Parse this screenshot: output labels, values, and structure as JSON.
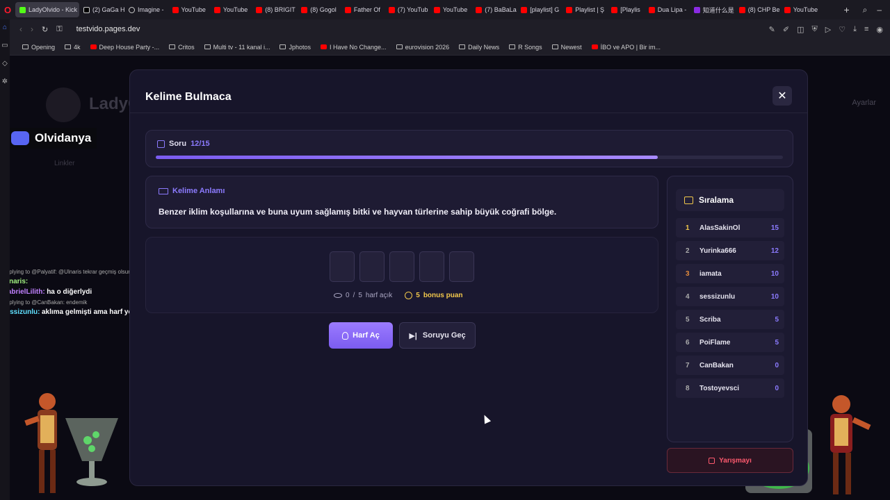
{
  "browser": {
    "tabs": [
      {
        "label": "LadyOlvido - Kick",
        "icon": "kick",
        "active": true
      },
      {
        "label": "(2) GaGa H",
        "icon": "x"
      },
      {
        "label": "Imagine -",
        "icon": "circ"
      },
      {
        "label": "YouTube",
        "icon": "yt"
      },
      {
        "label": "YouTube",
        "icon": "yt"
      },
      {
        "label": "(8) BRIGIT",
        "icon": "yt"
      },
      {
        "label": "(8) Gogol",
        "icon": "yt"
      },
      {
        "label": "Father Of",
        "icon": "yt"
      },
      {
        "label": "(7) YouTub",
        "icon": "yt"
      },
      {
        "label": "YouTube",
        "icon": "yt"
      },
      {
        "label": "(7) BaBaLa",
        "icon": "yt"
      },
      {
        "label": "[playlist] G",
        "icon": "yt"
      },
      {
        "label": "Playlist | Ş",
        "icon": "yt"
      },
      {
        "label": "[Playlis",
        "icon": "yt"
      },
      {
        "label": "Dua Lipa -",
        "icon": "yt"
      },
      {
        "label": "知道什么是",
        "icon": "purple"
      },
      {
        "label": "(8) CHP Be",
        "icon": "yt"
      },
      {
        "label": "YouTube",
        "icon": "yt"
      }
    ],
    "url": "testvido.pages.dev",
    "bookmarks": [
      {
        "label": "Opening",
        "icon": "folder"
      },
      {
        "label": "4k",
        "icon": "folder"
      },
      {
        "label": "Deep House Party -...",
        "icon": "yt"
      },
      {
        "label": "Critos",
        "icon": "folder"
      },
      {
        "label": "Multi tv - 11 kanal i...",
        "icon": "folder"
      },
      {
        "label": "Jphotos",
        "icon": "folder"
      },
      {
        "label": "I Have No Change...",
        "icon": "yt"
      },
      {
        "label": "eurovision 2026",
        "icon": "folder"
      },
      {
        "label": "Daily News",
        "icon": "folder"
      },
      {
        "label": "R Songs",
        "icon": "folder"
      },
      {
        "label": "Newest",
        "icon": "folder"
      },
      {
        "label": "İBO ve APO | Bir im...",
        "icon": "yt"
      }
    ]
  },
  "background": {
    "channel_name": "LadyO",
    "settings_label": "Ayarlar",
    "links_label": "Linkler"
  },
  "overlay": {
    "discord_name": "Olvidanya",
    "chat": [
      {
        "type": "reply",
        "text": "Replying to @Palyatif: @Ulnaris tekrar geçmiş olsun"
      },
      {
        "type": "msg",
        "user": "Ulnaris:",
        "user_class": "user1",
        "text": ""
      },
      {
        "type": "msg",
        "user": "GabrielLilith:",
        "user_class": "user2",
        "text": "ha o diğerlydi"
      },
      {
        "type": "reply",
        "text": "Replying to @CanBakan: endemik"
      },
      {
        "type": "msg",
        "user": "sessizunlu:",
        "user_class": "user3",
        "text": "aklıma gelmişti ama harf yetmedi"
      }
    ]
  },
  "modal": {
    "title": "Kelime Bulmaca",
    "progress": {
      "label": "Soru",
      "current": "12",
      "total": "/15",
      "fraction": 0.8
    },
    "meaning": {
      "heading": "Kelime Anlamı",
      "text": "Benzer iklim koşullarına ve buna uyum sağlamış bitki ve hayvan türlerine sahip büyük coğrafi bölge."
    },
    "answer": {
      "letters": [
        "",
        "",
        "",
        "",
        ""
      ],
      "open_count": "0",
      "separator": "/",
      "total_count": "5",
      "open_label": "harf açık",
      "bonus_value": "5",
      "bonus_label": "bonus puan"
    },
    "buttons": {
      "hint": "Harf Aç",
      "skip": "Soruyu Geç",
      "leave": "Yarışmayı"
    },
    "ranking": {
      "title": "Sıralama",
      "rows": [
        {
          "pos": "1",
          "name": "AlasSakinOl",
          "score": "15"
        },
        {
          "pos": "2",
          "name": "Yurinka666",
          "score": "12"
        },
        {
          "pos": "3",
          "name": "iamata",
          "score": "10"
        },
        {
          "pos": "4",
          "name": "sessizunlu",
          "score": "10"
        },
        {
          "pos": "5",
          "name": "Scriba",
          "score": "5"
        },
        {
          "pos": "6",
          "name": "PoiFlame",
          "score": "5"
        },
        {
          "pos": "7",
          "name": "CanBakan",
          "score": "0"
        },
        {
          "pos": "8",
          "name": "Tostoyevsci",
          "score": "0"
        }
      ]
    }
  }
}
